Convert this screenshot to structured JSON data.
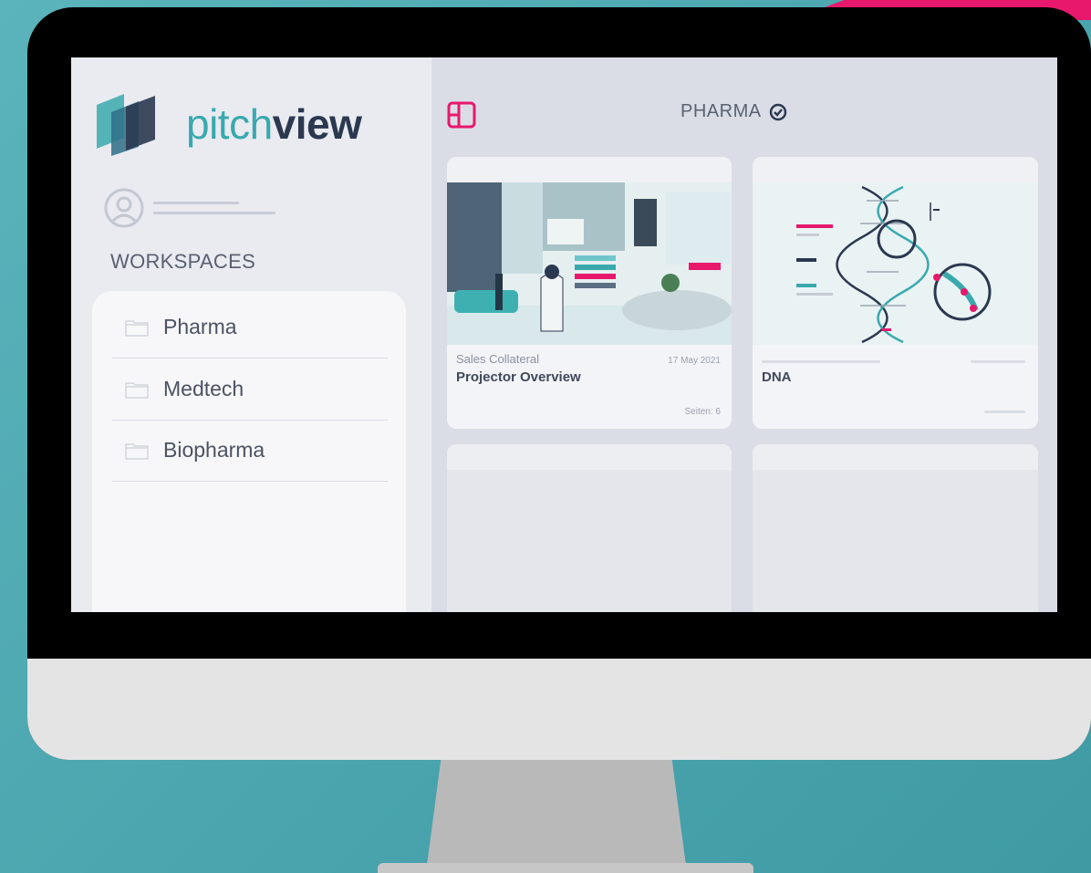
{
  "app": {
    "brand_light": "pitch",
    "brand_bold": "view"
  },
  "sidebar": {
    "section_title": "WORKSPACES",
    "items": [
      {
        "label": "Pharma",
        "icon": "folder-icon"
      },
      {
        "label": "Medtech",
        "icon": "folder-icon"
      },
      {
        "label": "Biopharma",
        "icon": "folder-icon"
      }
    ]
  },
  "header": {
    "title": "PHARMA",
    "layout_icon": "layout-icon",
    "status_icon": "check-circle-icon"
  },
  "cards": [
    {
      "category": "Sales Collateral",
      "date": "17 May 2021",
      "title": "Projector Overview",
      "pages": "Seiten: 6"
    },
    {
      "title": "DNA"
    }
  ],
  "colors": {
    "accent": "#e8186c",
    "brand_teal": "#3aa9ad",
    "brand_navy": "#2b3850",
    "background": "#4aa5ae"
  }
}
